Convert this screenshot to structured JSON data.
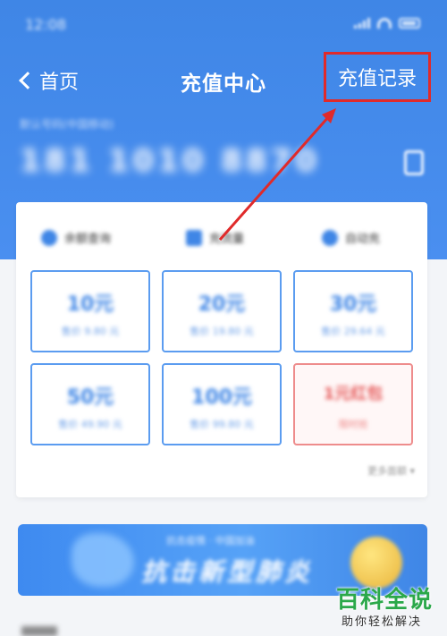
{
  "status_bar": {
    "time": "12:08"
  },
  "nav": {
    "back_label": "首页",
    "title": "充值中心",
    "record_label": "充值记录"
  },
  "account": {
    "caption": "默认号码(中国移动)",
    "phone": "181 1010 8870"
  },
  "tabs": [
    {
      "label": "余额查询",
      "icon": "balance-icon"
    },
    {
      "label": "充流量",
      "icon": "data-icon"
    },
    {
      "label": "自动充",
      "icon": "auto-icon"
    }
  ],
  "amounts": [
    {
      "main": "10元",
      "sub": "售价 9.80 元"
    },
    {
      "main": "20元",
      "sub": "售价 19.80 元"
    },
    {
      "main": "30元",
      "sub": "售价 29.64 元"
    },
    {
      "main": "50元",
      "sub": "售价 49.90 元"
    },
    {
      "main": "100元",
      "sub": "售价 99.80 元"
    },
    {
      "main": "1元红包",
      "sub": "限时抢"
    }
  ],
  "more_label": "更多面额 ▾",
  "banner": {
    "small_text": "抗击疫情 · 中国加油",
    "big_text": "抗击新型肺炎"
  },
  "watermark": {
    "main": "百科全说",
    "sub": "助你轻松解决"
  },
  "colors": {
    "primary": "#3f86e6",
    "highlight_box": "#e02a2a",
    "watermark_green": "#2ba84a"
  }
}
